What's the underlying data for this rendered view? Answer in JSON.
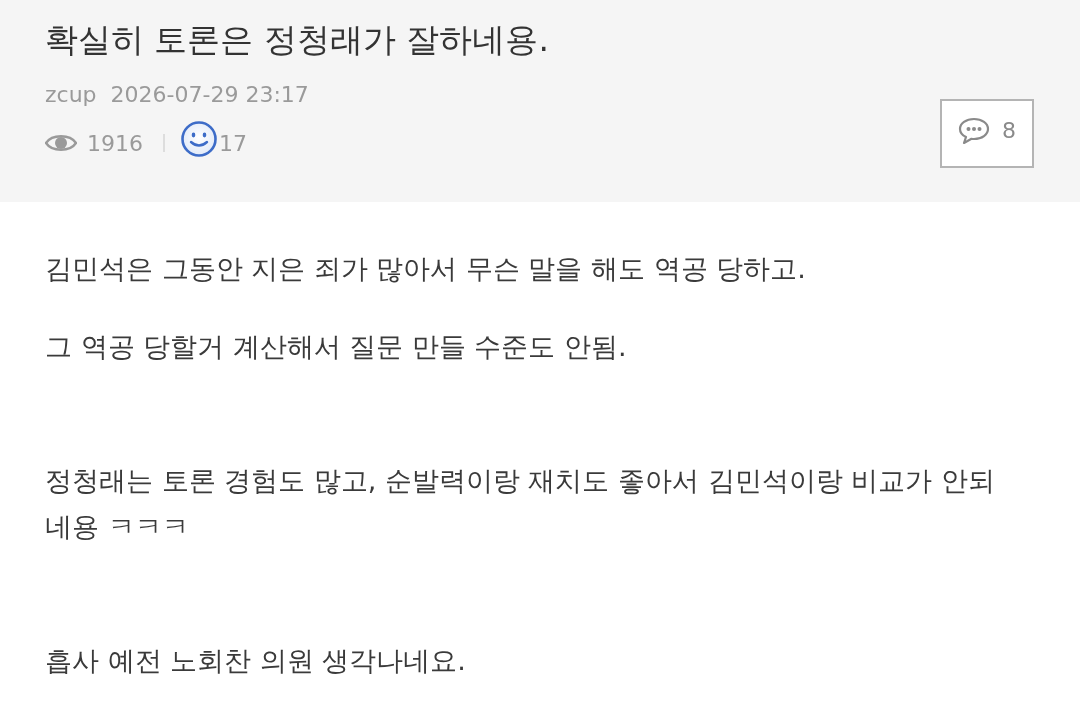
{
  "post": {
    "title": "확실히 토론은 정청래가 잘하네용.",
    "author": "zcup",
    "date": "2026-07-29 23:17",
    "views": "1916",
    "reactions": "17",
    "comments": "8"
  },
  "body": {
    "paragraphs": [
      "김민석은 그동안 지은 죄가 많아서 무슨 말을 해도 역공 당하고.",
      "그 역공 당할거 계산해서 질문 만들 수준도 안됨.",
      "정청래는 토론 경험도 많고, 순발력이랑 재치도 좋아서 김민석이랑 비교가 안되네용 ㅋㅋㅋ",
      "흡사 예전 노회찬 의원 생각나네요."
    ]
  }
}
